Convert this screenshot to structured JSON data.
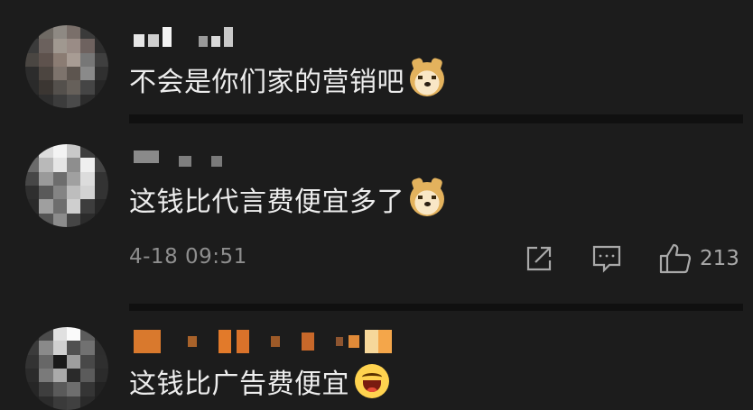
{
  "comments": [
    {
      "text": "不会是你们家的营销吧",
      "emoji": "doge"
    },
    {
      "text": "这钱比代言费便宜多了",
      "emoji": "doge",
      "timestamp": "4-18 09:51",
      "like_count": "213",
      "icons": [
        "share-icon",
        "comment-icon",
        "like-icon"
      ]
    },
    {
      "text": "这钱比广告费便宜",
      "emoji": "laughing"
    }
  ],
  "colors": {
    "background": "#1c1c1c",
    "text": "#ededed",
    "meta": "#8e8e8e"
  }
}
